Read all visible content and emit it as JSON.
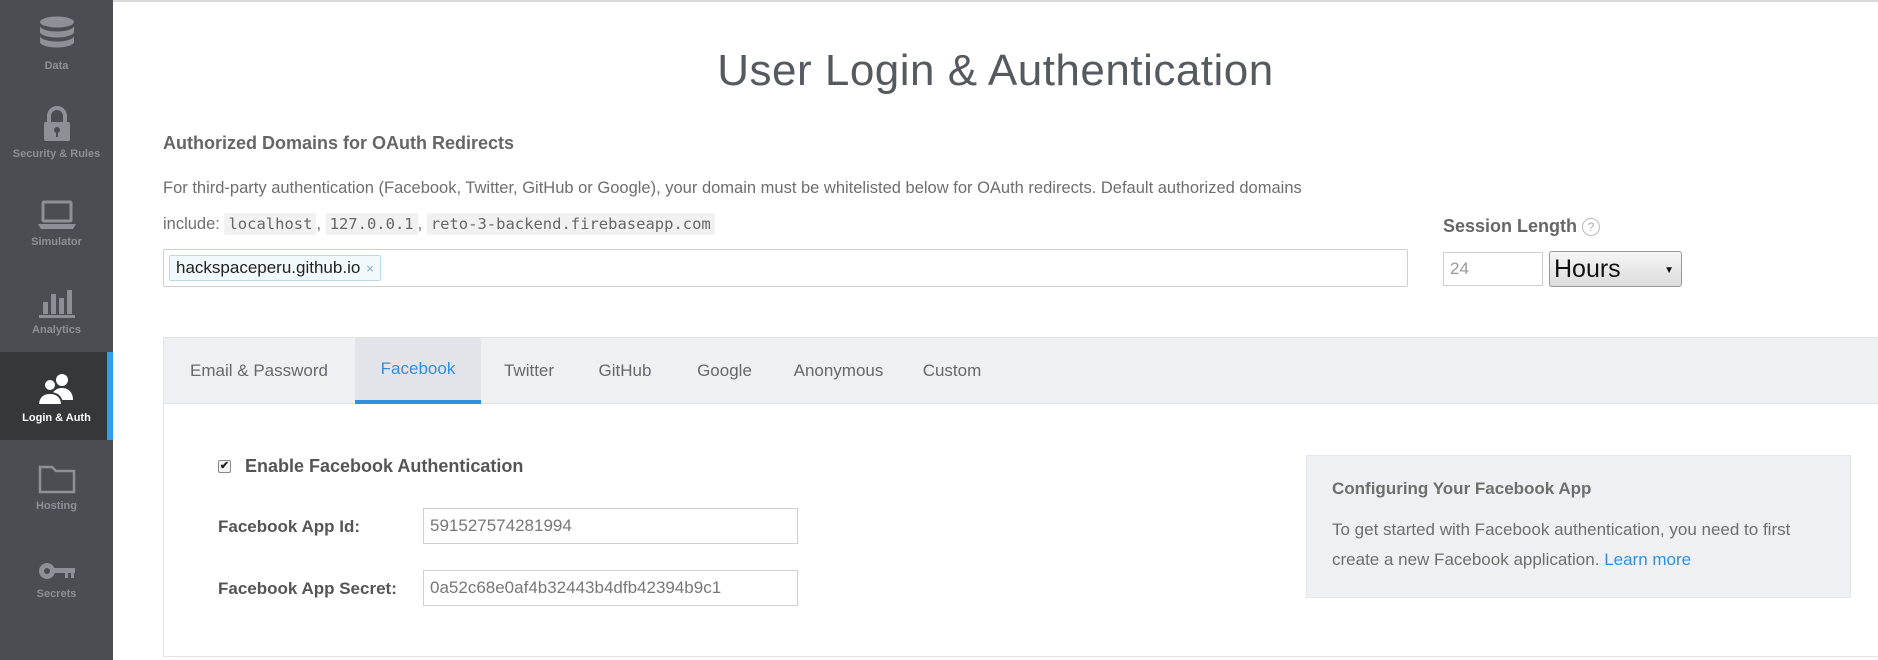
{
  "sidebar": {
    "items": [
      {
        "label": "Data",
        "icon": "database-icon"
      },
      {
        "label": "Security & Rules",
        "icon": "lock-icon"
      },
      {
        "label": "Simulator",
        "icon": "laptop-icon"
      },
      {
        "label": "Analytics",
        "icon": "bar-chart-icon"
      },
      {
        "label": "Login & Auth",
        "icon": "users-icon",
        "active": true
      },
      {
        "label": "Hosting",
        "icon": "folder-icon"
      },
      {
        "label": "Secrets",
        "icon": "key-icon"
      }
    ]
  },
  "page": {
    "title": "User Login & Authentication"
  },
  "domains": {
    "heading": "Authorized Domains for OAuth Redirects",
    "description_line1": "For third-party authentication (Facebook, Twitter, GitHub or Google), your domain must be whitelisted below for OAuth redirects. Default authorized domains",
    "description_include": "include:",
    "defaults": [
      "localhost",
      "127.0.0.1",
      "reto-3-backend.firebaseapp.com"
    ],
    "tag": "hackspaceperu.github.io",
    "tag_remove": "×"
  },
  "session": {
    "label": "Session Length",
    "help": "?",
    "value": "24",
    "unit": "Hours"
  },
  "tabs": [
    "Email & Password",
    "Facebook",
    "Twitter",
    "GitHub",
    "Google",
    "Anonymous",
    "Custom"
  ],
  "active_tab": "Facebook",
  "facebook": {
    "enable_label": "Enable Facebook Authentication",
    "enabled": true,
    "app_id_label": "Facebook App Id:",
    "app_id_value": "591527574281994",
    "app_secret_label": "Facebook App Secret:",
    "app_secret_value": "0a52c68e0af4b32443b4dfb42394b9c1"
  },
  "info": {
    "heading": "Configuring Your Facebook App",
    "text": "To get started with Facebook authentication, you need to first create a new Facebook application.",
    "link": "Learn more"
  },
  "colors": {
    "sidebar_bg": "#4a4d52",
    "accent": "#2e90e0"
  }
}
